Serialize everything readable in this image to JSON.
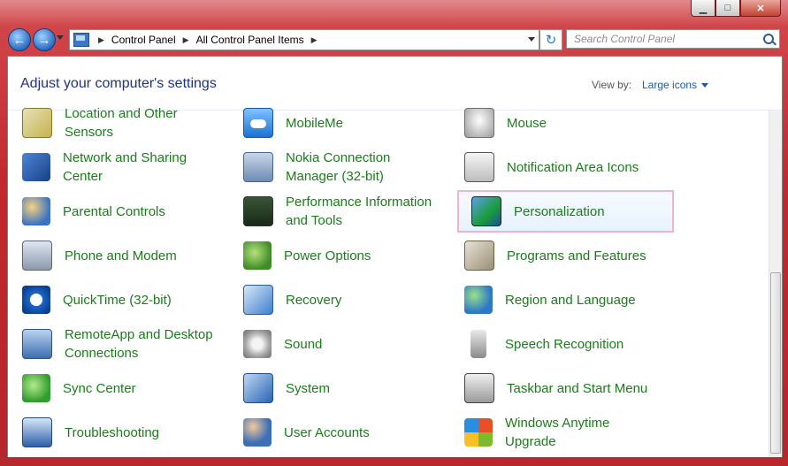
{
  "window": {
    "minimize_glyph": "▁",
    "maximize_glyph": "□",
    "close_glyph": "✕"
  },
  "toolbar": {
    "back_glyph": "←",
    "forward_glyph": "→",
    "breadcrumbs": [
      "Control Panel",
      "All Control Panel Items"
    ],
    "separator": "▶",
    "refresh_glyph": "↻",
    "search_placeholder": "Search Control Panel"
  },
  "header": {
    "title": "Adjust your computer's settings",
    "view_by_label": "View by:",
    "view_by_value": "Large icons"
  },
  "items": [
    {
      "label": "Location and Other\nSensors",
      "icon": "location-sensors-icon"
    },
    {
      "label": "MobileMe",
      "icon": "mobileme-icon"
    },
    {
      "label": "Mouse",
      "icon": "mouse-icon"
    },
    {
      "label": "Network and Sharing\nCenter",
      "icon": "network-icon"
    },
    {
      "label": "Nokia Connection\nManager (32-bit)",
      "icon": "nokia-icon"
    },
    {
      "label": "Notification Area Icons",
      "icon": "notification-icon"
    },
    {
      "label": "Parental Controls",
      "icon": "parental-controls-icon"
    },
    {
      "label": "Performance Information\nand Tools",
      "icon": "performance-icon"
    },
    {
      "label": "Personalization",
      "icon": "personalization-icon"
    },
    {
      "label": "Phone and Modem",
      "icon": "phone-modem-icon"
    },
    {
      "label": "Power Options",
      "icon": "power-icon"
    },
    {
      "label": "Programs and Features",
      "icon": "programs-icon"
    },
    {
      "label": "QuickTime (32-bit)",
      "icon": "quicktime-icon"
    },
    {
      "label": "Recovery",
      "icon": "recovery-icon"
    },
    {
      "label": "Region and Language",
      "icon": "region-icon"
    },
    {
      "label": "RemoteApp and Desktop\nConnections",
      "icon": "remoteapp-icon"
    },
    {
      "label": "Sound",
      "icon": "sound-icon"
    },
    {
      "label": "Speech Recognition",
      "icon": "microphone-icon"
    },
    {
      "label": "Sync Center",
      "icon": "sync-icon"
    },
    {
      "label": "System",
      "icon": "system-icon"
    },
    {
      "label": "Taskbar and Start Menu",
      "icon": "taskbar-icon"
    },
    {
      "label": "Troubleshooting",
      "icon": "troubleshooting-icon"
    },
    {
      "label": "User Accounts",
      "icon": "user-accounts-icon"
    },
    {
      "label": "Windows Anytime\nUpgrade",
      "icon": "windows-logo-icon"
    }
  ],
  "selected_item": "Personalization",
  "colors": {
    "frame": "#c2282d",
    "link_green": "#1a7d1a",
    "heading_blue": "#1e3287",
    "selection_border": "#f0b4cf"
  }
}
